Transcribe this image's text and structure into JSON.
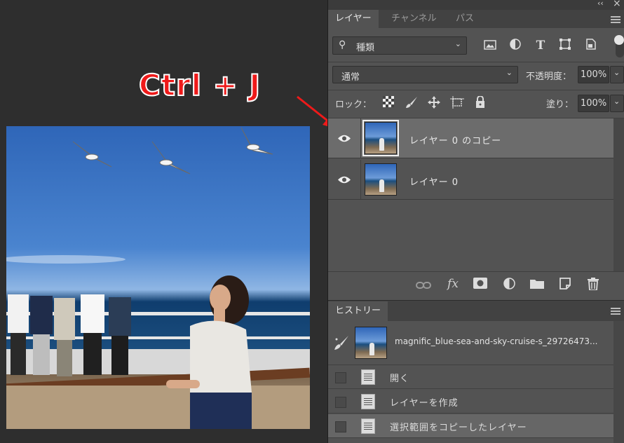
{
  "annotation": {
    "shortcut": "Ctrl + J",
    "color": "#ee1a1a"
  },
  "window": {
    "collapse_glyph": "‹‹",
    "close_glyph": "×"
  },
  "layers_panel": {
    "tabs": [
      "レイヤー",
      "チャンネル",
      "パス"
    ],
    "active_tab": 0,
    "filter": {
      "label": "種類",
      "icons": [
        "image-filter-icon",
        "adjustment-filter-icon",
        "type-filter-icon",
        "shape-filter-icon",
        "smart-object-filter-icon"
      ]
    },
    "blend_mode": "通常",
    "opacity_label": "不透明度：",
    "opacity_value": "100%",
    "lock_label": "ロック：",
    "fill_label": "塗り：",
    "fill_value": "100%",
    "layers": [
      {
        "name": "レイヤー 0 のコピー",
        "selected": true,
        "visible": true
      },
      {
        "name": "レイヤー 0",
        "selected": false,
        "visible": true
      }
    ],
    "footer_icons": [
      "link-layers-icon",
      "fx-icon",
      "add-mask-icon",
      "adjustment-layer-icon",
      "group-folder-icon",
      "new-layer-icon",
      "trash-icon"
    ]
  },
  "history_panel": {
    "tab": "ヒストリー",
    "snapshot_name": "magnific_blue-sea-and-sky-cruise-s_29726473...",
    "steps": [
      "開く",
      "レイヤーを作成",
      "選択範囲をコピーしたレイヤー"
    ],
    "active_step": 2
  }
}
